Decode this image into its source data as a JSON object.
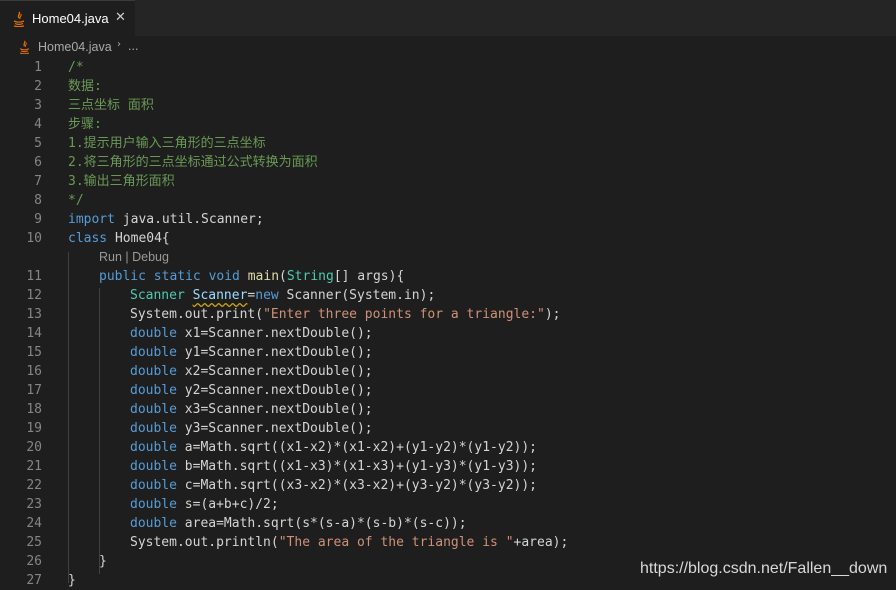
{
  "tab": {
    "file_name": "Home04.java",
    "close_glyph": "✕"
  },
  "breadcrumb": {
    "file_name": "Home04.java",
    "separator": "›",
    "more": "..."
  },
  "codelens": {
    "label": "Run | Debug"
  },
  "line_numbers": [
    "1",
    "2",
    "3",
    "4",
    "5",
    "6",
    "7",
    "8",
    "9",
    "10",
    "11",
    "12",
    "13",
    "14",
    "15",
    "16",
    "17",
    "18",
    "19",
    "20",
    "21",
    "22",
    "23",
    "24",
    "25",
    "26",
    "27"
  ],
  "code": {
    "l1": "/*",
    "l2": "数据:",
    "l3": "三点坐标 面积",
    "l4": "步骤:",
    "l5": "1.提示用户输入三角形的三点坐标",
    "l6": "2.将三角形的三点坐标通过公式转换为面积",
    "l7": "3.输出三角形面积",
    "l8": "*/",
    "l9": {
      "kw": "import",
      "rest": " java.util.Scanner;"
    },
    "l10": {
      "kw": "class",
      "rest": " Home04{"
    },
    "l11": {
      "kw": "public static void",
      "fn": "main",
      "p1": "(",
      "type": "String",
      "rest": "[] args){"
    },
    "l12": {
      "type": "Scanner",
      "sp": " ",
      "var": "Scanner",
      "eq": "=",
      "kw": "new",
      "rest": " Scanner(System.in);"
    },
    "l13": {
      "pre": "System.out.print(",
      "str": "\"Enter three points for a triangle:\"",
      "post": ");"
    },
    "l14": {
      "kw": "double",
      "rest": " x1=Scanner.nextDouble();"
    },
    "l15": {
      "kw": "double",
      "rest": " y1=Scanner.nextDouble();"
    },
    "l16": {
      "kw": "double",
      "rest": " x2=Scanner.nextDouble();"
    },
    "l17": {
      "kw": "double",
      "rest": " y2=Scanner.nextDouble();"
    },
    "l18": {
      "kw": "double",
      "rest": " x3=Scanner.nextDouble();"
    },
    "l19": {
      "kw": "double",
      "rest": " y3=Scanner.nextDouble();"
    },
    "l20": {
      "kw": "double",
      "rest": " a=Math.sqrt((x1-x2)*(x1-x2)+(y1-y2)*(y1-y2));"
    },
    "l21": {
      "kw": "double",
      "rest": " b=Math.sqrt((x1-x3)*(x1-x3)+(y1-y3)*(y1-y3));"
    },
    "l22": {
      "kw": "double",
      "rest": " c=Math.sqrt((x3-x2)*(x3-x2)+(y3-y2)*(y3-y2));"
    },
    "l23": {
      "kw": "double",
      "rest": " s=(a+b+c)/2;"
    },
    "l24": {
      "kw": "double",
      "rest": " area=Math.sqrt(s*(s-a)*(s-b)*(s-c));"
    },
    "l25": {
      "pre": "System.out.println(",
      "str": "\"The area of the triangle is \"",
      "post": "+area);"
    },
    "l26": "}",
    "l27": "}"
  },
  "watermark": "https://blog.csdn.net/Fallen__down",
  "colors": {
    "background": "#1e1e1e",
    "comment": "#6a9955",
    "keyword": "#569cd6",
    "type": "#4ec9b0",
    "string": "#ce9178",
    "line_number": "#858585"
  }
}
